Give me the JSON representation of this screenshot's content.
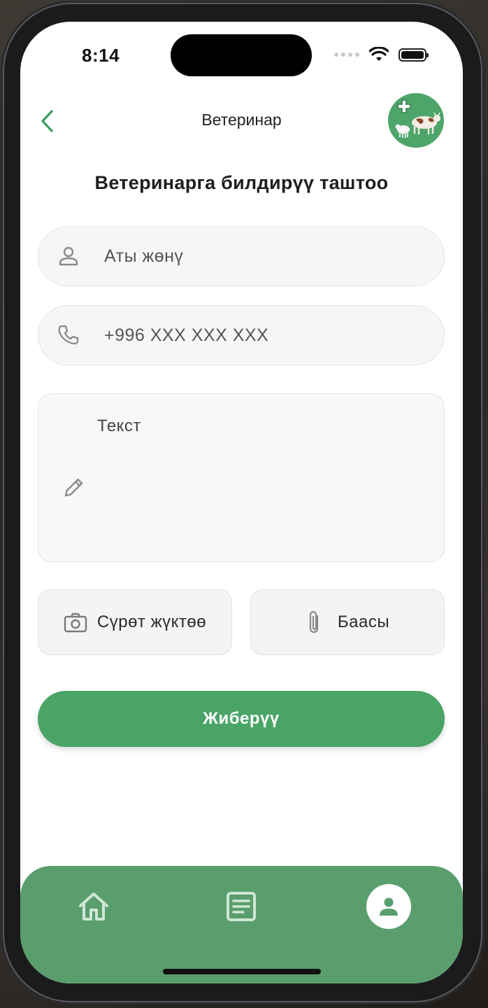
{
  "status_bar": {
    "time": "8:14"
  },
  "header": {
    "title": "Ветеринар"
  },
  "page": {
    "heading": "Ветеринарга билдирүү таштоо"
  },
  "form": {
    "name_placeholder": "Аты жөнү",
    "phone_placeholder": "+996 XXX XXX XXX",
    "text_placeholder": "Текст",
    "photo_button_label": "Сүрөт жүктөө",
    "attach_button_label": "Баасы",
    "submit_label": "Жиберүү"
  },
  "bottom_nav": {
    "items": [
      {
        "icon": "home-icon",
        "active": false
      },
      {
        "icon": "document-icon",
        "active": false
      },
      {
        "icon": "profile-icon",
        "active": true
      }
    ]
  },
  "colors": {
    "accent": "#4aa466",
    "nav_bg": "#5a9e6e",
    "field_bg": "#f6f6f6"
  }
}
